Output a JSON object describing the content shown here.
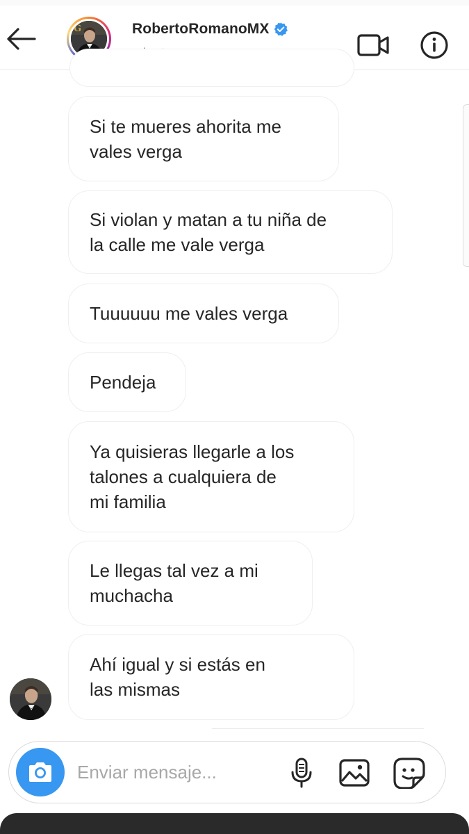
{
  "header": {
    "username": "RobertoRomanoMX",
    "handle": "robertoromanomx",
    "verified": true,
    "accent_color": "#3897f0"
  },
  "icons": {
    "back": "arrow-left-icon",
    "video_call": "video-camera-icon",
    "info": "info-icon",
    "verified": "verified-badge-icon",
    "camera": "camera-icon",
    "microphone": "microphone-icon",
    "gallery": "image-icon",
    "sticker": "sticker-icon"
  },
  "messages": [
    {
      "lines": [
        "Si te mueres ahorita me",
        "vales verga"
      ]
    },
    {
      "lines": [
        "Si violan y matan a tu niña de",
        "la calle me vale verga"
      ]
    },
    {
      "lines": [
        "Tuuuuuu me vales verga"
      ]
    },
    {
      "lines": [
        "Pendeja"
      ]
    },
    {
      "lines": [
        "Ya quisieras llegarle a los",
        "talones a cualquiera de",
        "mi familia"
      ]
    },
    {
      "lines": [
        "Le llegas tal vez a mi",
        "muchacha"
      ]
    },
    {
      "lines": [
        "Ahí igual y si estás en",
        "las mismas"
      ]
    }
  ],
  "composer": {
    "placeholder": "Enviar mensaje..."
  }
}
